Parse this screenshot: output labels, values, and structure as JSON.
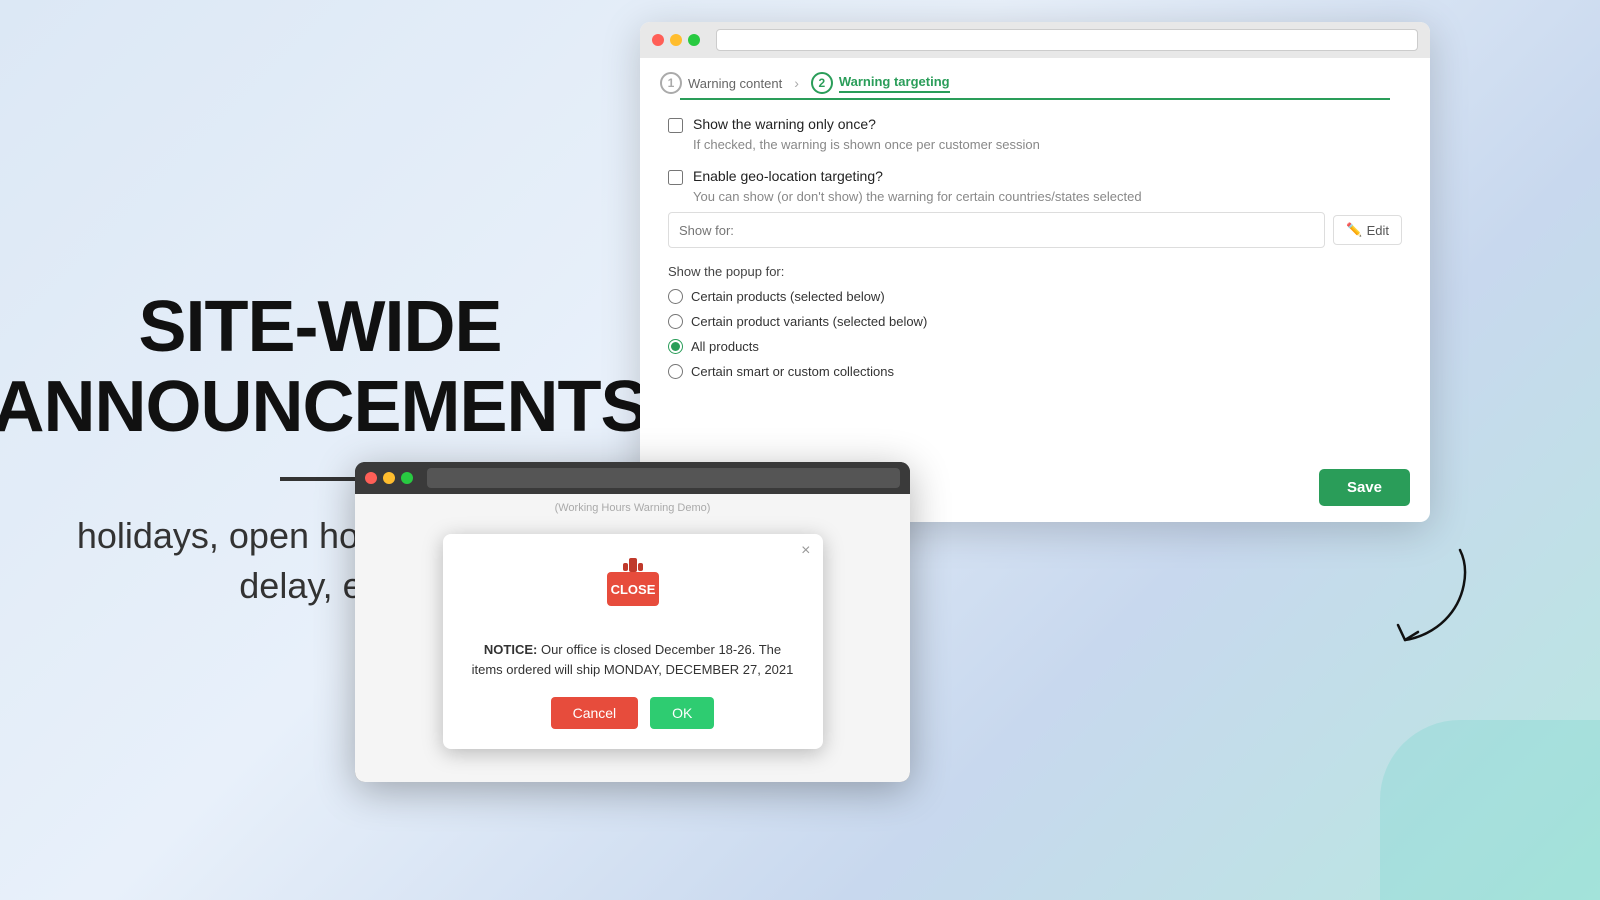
{
  "background": {
    "color": "#dce8f5"
  },
  "left_panel": {
    "title_line1": "SITE-WIDE",
    "title_line2": "ANNOUNCEMENTS",
    "subtitle": "holidays, open hours, shipping delay, etc."
  },
  "browser_main": {
    "stepper": {
      "step1": {
        "number": "1",
        "label": "Warning content"
      },
      "step2": {
        "number": "2",
        "label": "Warning targeting"
      }
    },
    "form": {
      "show_once_label": "Show the warning only once?",
      "show_once_hint": "If checked, the warning is shown once per customer session",
      "geo_label": "Enable geo-location targeting?",
      "geo_hint": "You can show (or don't show) the warning for certain countries/states selected",
      "geo_input_placeholder": "Show for:",
      "geo_edit_btn": "Edit",
      "popup_section_label": "Show the popup for:",
      "radio_options": [
        "Certain products (selected below)",
        "Certain product variants (selected below)",
        "All products",
        "Certain smart or custom collections"
      ],
      "radio_selected_index": 2
    },
    "save_btn": "Save"
  },
  "browser_demo": {
    "address_bar_text": "(Working Hours Warning Demo)",
    "popup": {
      "close_x": "×",
      "icon_text": "CLOSE",
      "notice_bold": "NOTICE:",
      "notice_text": " Our office is closed December 18-26. The items ordered will ship MONDAY, DECEMBER 27, 2021",
      "cancel_btn": "Cancel",
      "ok_btn": "OK"
    }
  }
}
